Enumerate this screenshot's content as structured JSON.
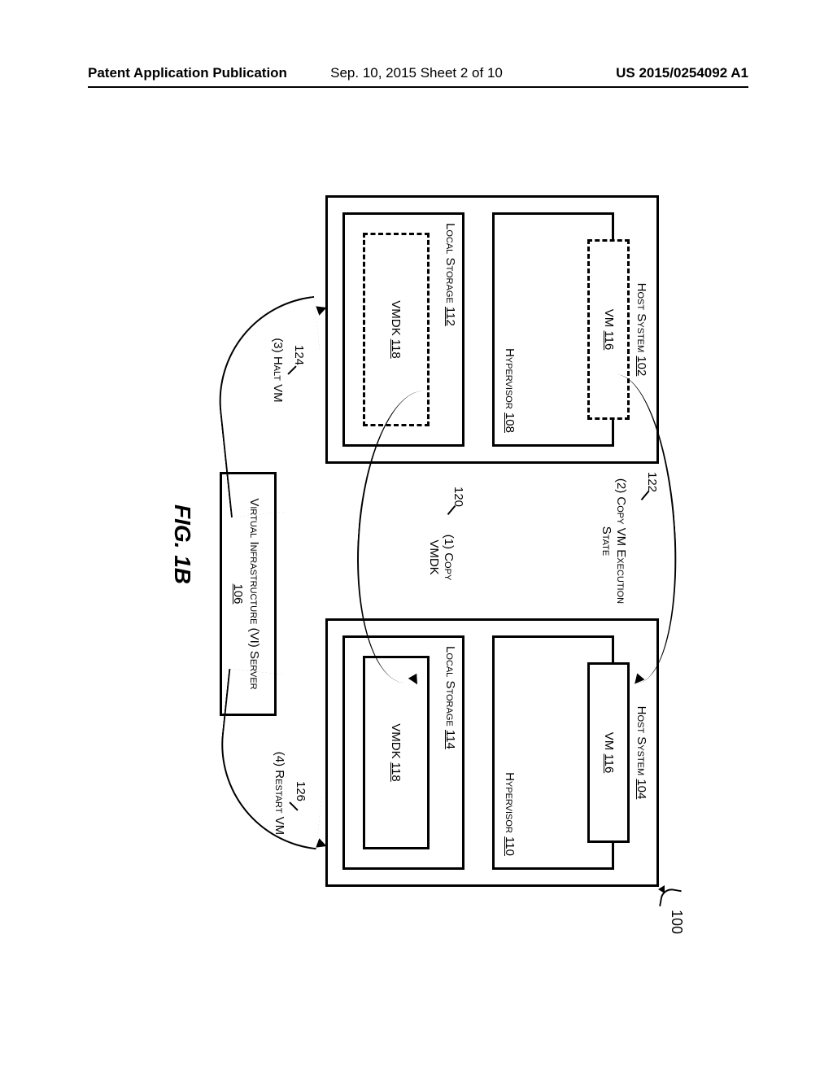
{
  "header": {
    "left": "Patent Application Publication",
    "center": "Sep. 10, 2015  Sheet 2 of 10",
    "right": "US 2015/0254092 A1"
  },
  "ref100": "100",
  "figure_label": "FIG. 1B",
  "host_left": {
    "title_text": "Host System",
    "title_ref": "102",
    "hypervisor_text": "Hypervisor",
    "hypervisor_ref": "108",
    "vm_text": "VM",
    "vm_ref": "116",
    "storage_text": "Local Storage",
    "storage_ref": "112",
    "vmdk_text": "VMDK",
    "vmdk_ref": "118"
  },
  "host_right": {
    "title_text": "Host System",
    "title_ref": "104",
    "hypervisor_text": "Hypervisor",
    "hypervisor_ref": "110",
    "vm_text": "VM",
    "vm_ref": "116",
    "storage_text": "Local Storage",
    "storage_ref": "114",
    "vmdk_text": "VMDK",
    "vmdk_ref": "118"
  },
  "vi": {
    "text": "Virtual Infrastructure (VI) Server",
    "ref": "106"
  },
  "annotations": {
    "ref122": "122",
    "copy_vm": "(2) Copy VM Execution State",
    "ref120": "120",
    "copy_vmdk": "(1) Copy VMDK",
    "ref124": "124",
    "halt": "(3) Halt VM",
    "ref126": "126",
    "restart": "(4) Restart VM"
  }
}
